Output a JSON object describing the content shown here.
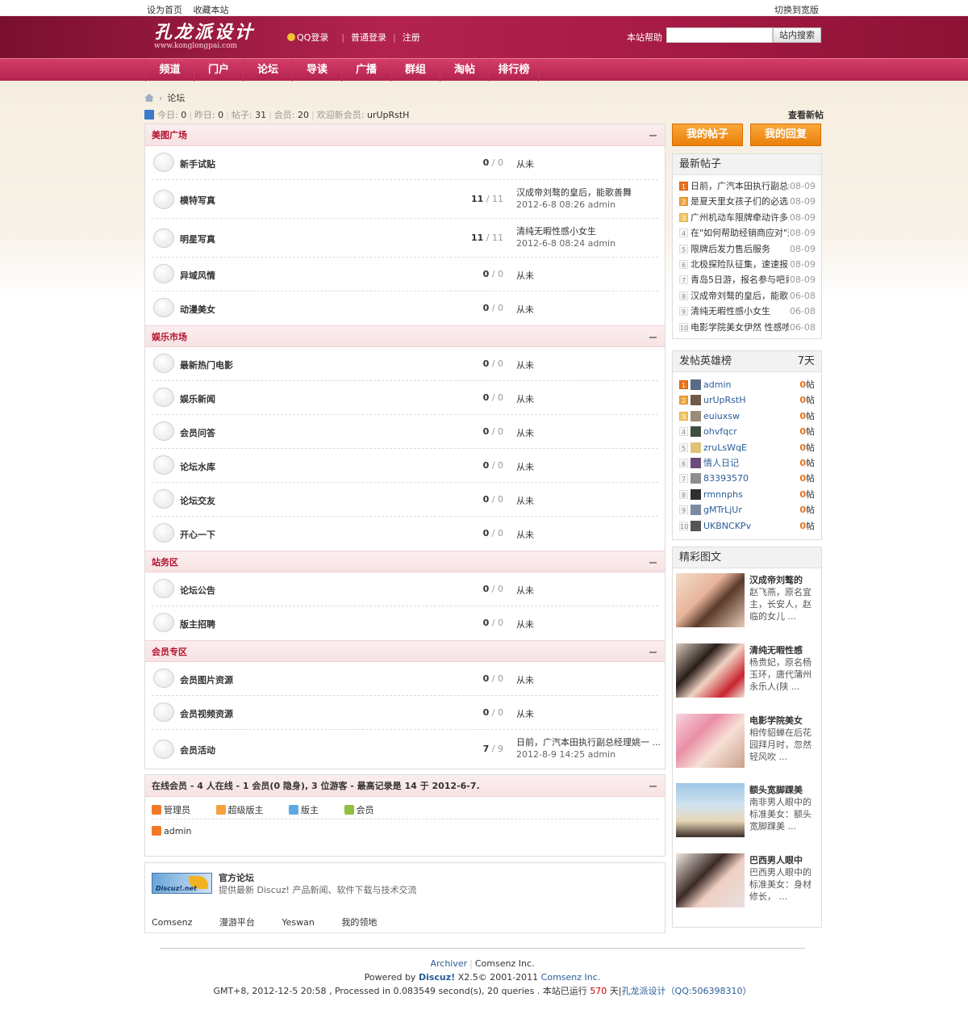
{
  "toplinks": {
    "sethome": "设为首页",
    "favorite": "收藏本站",
    "switch_width": "切换到宽版"
  },
  "header": {
    "logo_cn": "孔龙派设计",
    "logo_en": "www.konglongpai.com",
    "qq_login": "QQ登录",
    "normal_login": "普通登录",
    "register": "注册",
    "help": "本站帮助",
    "search_placeholder": "",
    "search_button": "站内搜索"
  },
  "nav": [
    "频道",
    "门户",
    "论坛",
    "导读",
    "广播",
    "群组",
    "淘帖",
    "排行榜"
  ],
  "breadcrumb": {
    "current": "论坛"
  },
  "stats": {
    "today_label": "今日:",
    "today": "0",
    "yesterday_label": "昨日:",
    "yesterday": "0",
    "posts_label": "帖子:",
    "posts": "31",
    "members_label": "会员:",
    "members": "20",
    "welcome_label": "欢迎新会员:",
    "new_member": "urUpRstH",
    "new_posts_link": "查看新帖"
  },
  "sections": [
    {
      "title": "美图广场",
      "forums": [
        {
          "name": "新手试贴",
          "threads": "0",
          "posts": "0",
          "last": "从未"
        },
        {
          "name": "模特写真",
          "threads": "11",
          "posts": "11",
          "last_title": "汉成帝刘骜的皇后，能歌善舞",
          "last_info": "2012-6-8 08:26 admin"
        },
        {
          "name": "明星写真",
          "threads": "11",
          "posts": "11",
          "last_title": "清纯无暇性感小女生",
          "last_info": "2012-6-8 08:24 admin"
        },
        {
          "name": "异域风情",
          "threads": "0",
          "posts": "0",
          "last": "从未"
        },
        {
          "name": "动漫美女",
          "threads": "0",
          "posts": "0",
          "last": "从未"
        }
      ]
    },
    {
      "title": "娱乐市场",
      "forums": [
        {
          "name": "最新热门电影",
          "threads": "0",
          "posts": "0",
          "last": "从未"
        },
        {
          "name": "娱乐新闻",
          "threads": "0",
          "posts": "0",
          "last": "从未"
        },
        {
          "name": "会员问答",
          "threads": "0",
          "posts": "0",
          "last": "从未"
        },
        {
          "name": "论坛水库",
          "threads": "0",
          "posts": "0",
          "last": "从未"
        },
        {
          "name": "论坛交友",
          "threads": "0",
          "posts": "0",
          "last": "从未"
        },
        {
          "name": "开心一下",
          "threads": "0",
          "posts": "0",
          "last": "从未"
        }
      ]
    },
    {
      "title": "站务区",
      "forums": [
        {
          "name": "论坛公告",
          "threads": "0",
          "posts": "0",
          "last": "从未"
        },
        {
          "name": "版主招聘",
          "threads": "0",
          "posts": "0",
          "last": "从未"
        }
      ]
    },
    {
      "title": "会员专区",
      "forums": [
        {
          "name": "会员图片资源",
          "threads": "0",
          "posts": "0",
          "last": "从未"
        },
        {
          "name": "会员视频资源",
          "threads": "0",
          "posts": "0",
          "last": "从未"
        },
        {
          "name": "会员活动",
          "threads": "7",
          "posts": "9",
          "last_title": "日前，广汽本田执行副总经理姚一 ...",
          "last_info": "2012-8-9 14:25 admin"
        }
      ]
    }
  ],
  "online": {
    "title": "在线会员 - 4 人在线 - 1 会员(0 隐身), 3 位游客 - 最高记录是 14 于 2012-6-7.",
    "legend": [
      "管理员",
      "超级版主",
      "版主",
      "会员"
    ],
    "users": [
      "admin"
    ],
    "colors": {
      "admin": "#f17a29",
      "super": "#f5a23c",
      "mod": "#5fa9e3",
      "member": "#8fc03f"
    }
  },
  "friendlinks": {
    "logo_text": "Discuz!.net",
    "title": "官方论坛",
    "desc": "提供最新 Discuz! 产品新闻、软件下载与技术交流",
    "texts": [
      "Comsenz",
      "漫游平台",
      "Yeswan",
      "我的领地"
    ]
  },
  "sidebar": {
    "my_threads": "我的帖子",
    "my_replies": "我的回复",
    "latest_title": "最新帖子",
    "latest": [
      {
        "num": "1",
        "title": "日前，广汽本田执行副总经",
        "date": "08-09"
      },
      {
        "num": "2",
        "title": "是夏天里女孩子们的必选单",
        "date": "08-09"
      },
      {
        "num": "3",
        "title": "广州机动车限牌牵动许多人",
        "date": "08-09"
      },
      {
        "num": "4",
        "title": "在\"如何帮助经销商应对\"这",
        "date": "08-09"
      },
      {
        "num": "5",
        "title": "限牌后发力售后服务",
        "date": "08-09"
      },
      {
        "num": "6",
        "title": "北极探险队征集，速速报名",
        "date": "08-09"
      },
      {
        "num": "7",
        "title": "青岛5日游，报名参与吧青",
        "date": "08-09"
      },
      {
        "num": "8",
        "title": "汉成帝刘骜的皇后，能歌善",
        "date": "06-08"
      },
      {
        "num": "9",
        "title": "清纯无暇性感小女生",
        "date": "06-08"
      },
      {
        "num": "10",
        "title": "电影学院美女伊然 性感喷",
        "date": "06-08"
      }
    ],
    "heroes_title": "发帖英雄榜",
    "heroes_period": "7天",
    "heroes": [
      {
        "num": "1",
        "name": "admin",
        "count": "0",
        "unit": "帖"
      },
      {
        "num": "2",
        "name": "urUpRstH",
        "count": "0",
        "unit": "帖"
      },
      {
        "num": "3",
        "name": "euiuxsw",
        "count": "0",
        "unit": "帖"
      },
      {
        "num": "4",
        "name": "ohvfqcr",
        "count": "0",
        "unit": "帖"
      },
      {
        "num": "5",
        "name": "zruLsWqE",
        "count": "0",
        "unit": "帖"
      },
      {
        "num": "6",
        "name": "情人日记",
        "count": "0",
        "unit": "帖"
      },
      {
        "num": "7",
        "name": "83393570",
        "count": "0",
        "unit": "帖"
      },
      {
        "num": "8",
        "name": "rmnnphs",
        "count": "0",
        "unit": "帖"
      },
      {
        "num": "9",
        "name": "gMTrLjUr",
        "count": "0",
        "unit": "帖"
      },
      {
        "num": "10",
        "name": "UKBNCKPv",
        "count": "0",
        "unit": "帖"
      }
    ],
    "pics_title": "精彩图文",
    "pics": [
      {
        "title": "汉成帝刘骜的",
        "desc": "赵飞燕，原名宜主，长安人，赵临的女儿 ..."
      },
      {
        "title": "清纯无暇性感",
        "desc": "杨贵妃，原名杨玉环，唐代蒲州永乐人(陕 ..."
      },
      {
        "title": "电影学院美女",
        "desc": "相传貂蝉在后花园拜月时，忽然轻风吹 ..."
      },
      {
        "title": "额头宽脚踝美",
        "desc": "南非男人眼中的标准美女：额头宽脚踝美 ..."
      },
      {
        "title": "巴西男人眼中",
        "desc": "巴西男人眼中的标准美女：身材修长， ..."
      }
    ]
  },
  "footer": {
    "archiver": "Archiver",
    "company": "Comsenz Inc.",
    "powered": "Powered by",
    "discuz": "Discuz!",
    "version": "X2.5© 2001-2011",
    "comsenz": "Comsenz Inc.",
    "gmt": "GMT+8, 2012-12-5 20:58 , Processed in 0.083549 second(s), 20 queries .",
    "running": "本站已运行",
    "days": "570",
    "days_unit": "天|",
    "site": "孔龙派设计",
    "qq": "（QQ:506398310）"
  }
}
